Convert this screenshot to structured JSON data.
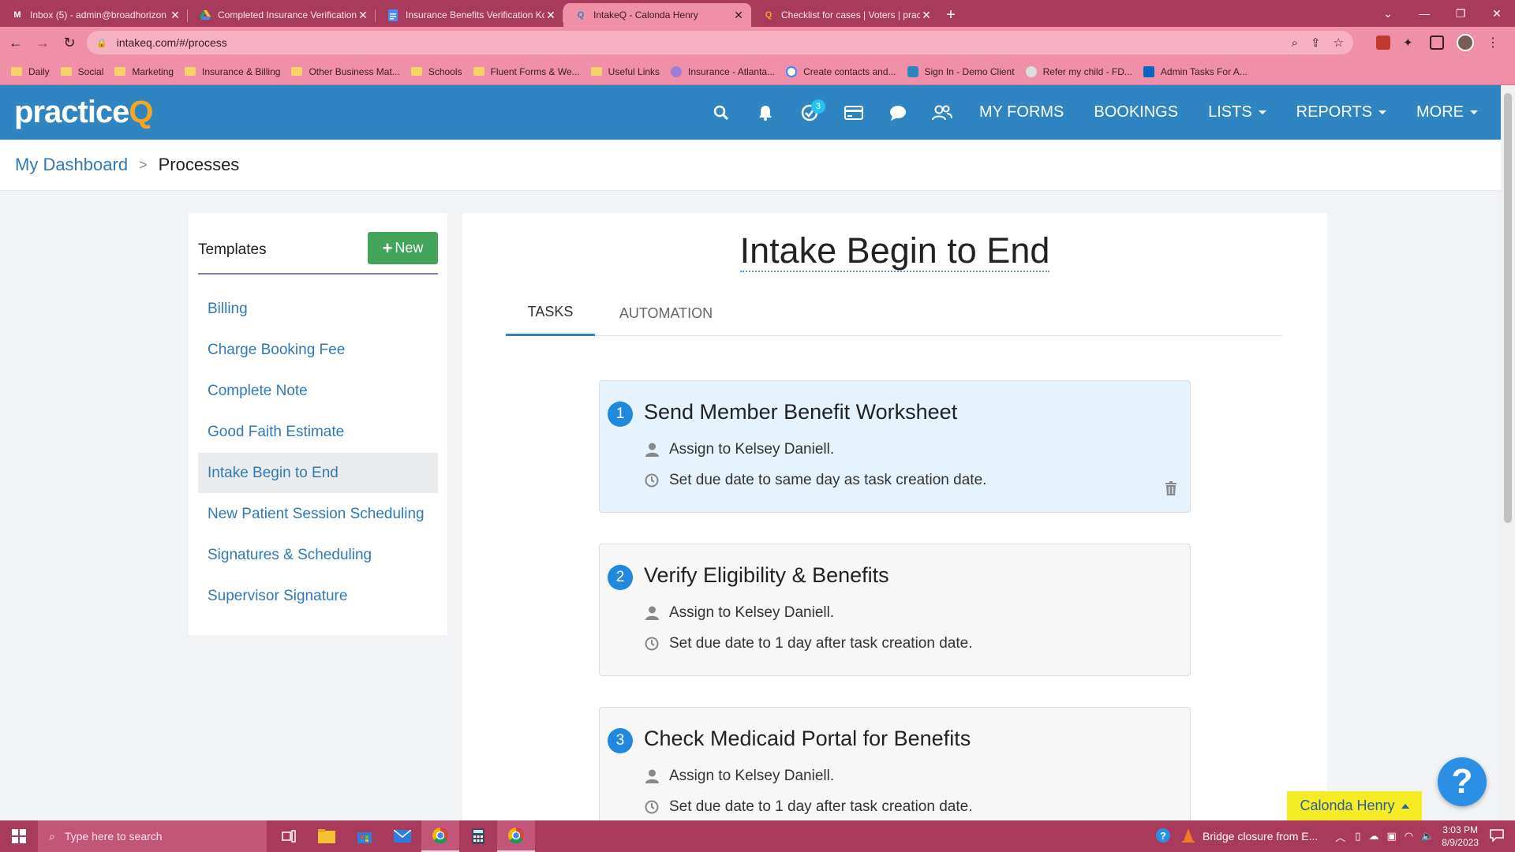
{
  "browser": {
    "tabs": [
      {
        "title": "Inbox (5) - admin@broadhorizon",
        "favicon": "gmail-icon"
      },
      {
        "title": "Completed Insurance Verification",
        "favicon": "drive-icon"
      },
      {
        "title": "Insurance Benefits Verification Kc",
        "favicon": "docs-icon"
      },
      {
        "title": "IntakeQ - Calonda Henry",
        "favicon": "intakeq-icon",
        "active": true
      },
      {
        "title": "Checklist for cases | Voters | prac",
        "favicon": "practiceq-icon"
      }
    ],
    "url": "intakeq.com/#/process",
    "bookmarks": [
      {
        "label": "Daily",
        "icon": "folder"
      },
      {
        "label": "Social",
        "icon": "folder"
      },
      {
        "label": "Marketing",
        "icon": "folder"
      },
      {
        "label": "Insurance & Billing",
        "icon": "folder"
      },
      {
        "label": "Other Business Mat...",
        "icon": "folder"
      },
      {
        "label": "Schools",
        "icon": "folder"
      },
      {
        "label": "Fluent Forms & We...",
        "icon": "folder"
      },
      {
        "label": "Useful Links",
        "icon": "folder"
      },
      {
        "label": "Insurance - Atlanta...",
        "icon": "people-icon"
      },
      {
        "label": "Create contacts and...",
        "icon": "google-icon"
      },
      {
        "label": "Sign In - Demo Client",
        "icon": "q-icon"
      },
      {
        "label": "Refer my child - FD...",
        "icon": "globe-icon"
      },
      {
        "label": "Admin Tasks For A...",
        "icon": "linkedin-icon"
      }
    ]
  },
  "app": {
    "logo_main": "practice",
    "logo_accent": "Q",
    "tasks_badge": "3",
    "nav": {
      "my_forms": "MY FORMS",
      "bookings": "BOOKINGS",
      "lists": "LISTS",
      "reports": "REPORTS",
      "more": "MORE"
    }
  },
  "breadcrumb": {
    "home": "My Dashboard",
    "separator": ">",
    "current": "Processes"
  },
  "templates": {
    "title": "Templates",
    "new_label": "New",
    "items": [
      {
        "label": "Billing"
      },
      {
        "label": "Charge Booking Fee"
      },
      {
        "label": "Complete Note"
      },
      {
        "label": "Good Faith Estimate"
      },
      {
        "label": "Intake Begin to End",
        "selected": true
      },
      {
        "label": "New Patient Session Scheduling"
      },
      {
        "label": "Signatures & Scheduling"
      },
      {
        "label": "Supervisor Signature"
      }
    ]
  },
  "process": {
    "title": "Intake Begin to End",
    "tabs": {
      "tasks": "TASKS",
      "automation": "AUTOMATION"
    },
    "tasks": [
      {
        "number": "1",
        "name": "Send Member Benefit Worksheet",
        "assign": "Assign to Kelsey Daniell.",
        "due": "Set due date to same day as task creation date."
      },
      {
        "number": "2",
        "name": "Verify Eligibility & Benefits",
        "assign": "Assign to Kelsey Daniell.",
        "due": "Set due date to 1 day after task creation date."
      },
      {
        "number": "3",
        "name": "Check Medicaid Portal for Benefits",
        "assign": "Assign to Kelsey Daniell.",
        "due": "Set due date to 1 day after task creation date."
      }
    ]
  },
  "help_label": "?",
  "user_chip": "Calonda Henry",
  "taskbar": {
    "search_placeholder": "Type here to search",
    "news": "Bridge closure from E...",
    "time": "3:03 PM",
    "date": "8/9/2023"
  },
  "colors": {
    "brand_blue": "#2e85c2",
    "accent_orange": "#f6a623",
    "new_green": "#43a55a",
    "link_blue": "#2e7ab8",
    "chrome_pink": "#a83a5c"
  }
}
